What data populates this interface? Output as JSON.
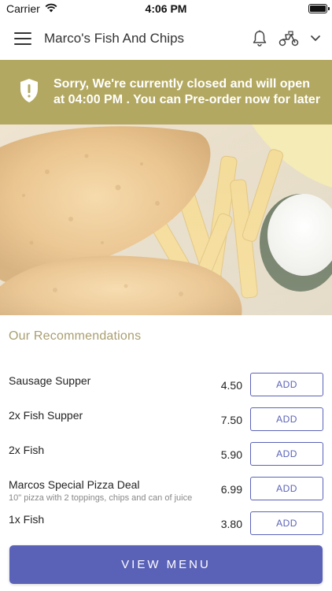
{
  "status": {
    "carrier": "Carrier",
    "time": "4:06 PM",
    "icons": [
      "wifi-icon",
      "battery-icon"
    ]
  },
  "header": {
    "title": "Marco's Fish And Chips",
    "icons": [
      "menu-icon",
      "bell-icon",
      "scooter-icon",
      "chevron-down-icon"
    ]
  },
  "banner": {
    "message": "Sorry, We're currently closed and will open at 04:00 PM . You can Pre-order now for later",
    "icon": "shield-alert-icon",
    "background": "#b3a861"
  },
  "hero": {
    "image": "fish-and-chips-photo"
  },
  "recommendations": {
    "title": "Our Recommendations",
    "items": [
      {
        "name": "Sausage Supper",
        "description": "",
        "price": "4.50",
        "button": "ADD"
      },
      {
        "name": "2x Fish Supper",
        "description": "",
        "price": "7.50",
        "button": "ADD"
      },
      {
        "name": "2x Fish",
        "description": "",
        "price": "5.90",
        "button": "ADD"
      },
      {
        "name": "Marcos Special Pizza Deal",
        "description": "10\" pizza with 2 toppings, chips and can of juice",
        "price": "6.99",
        "button": "ADD"
      },
      {
        "name": "1x Fish",
        "description": "",
        "price": "3.80",
        "button": "ADD"
      }
    ]
  },
  "footer": {
    "view_menu_label": "VIEW MENU"
  },
  "colors": {
    "accent": "#5a62b8",
    "banner": "#b3a861",
    "section_title": "#a99e70"
  }
}
